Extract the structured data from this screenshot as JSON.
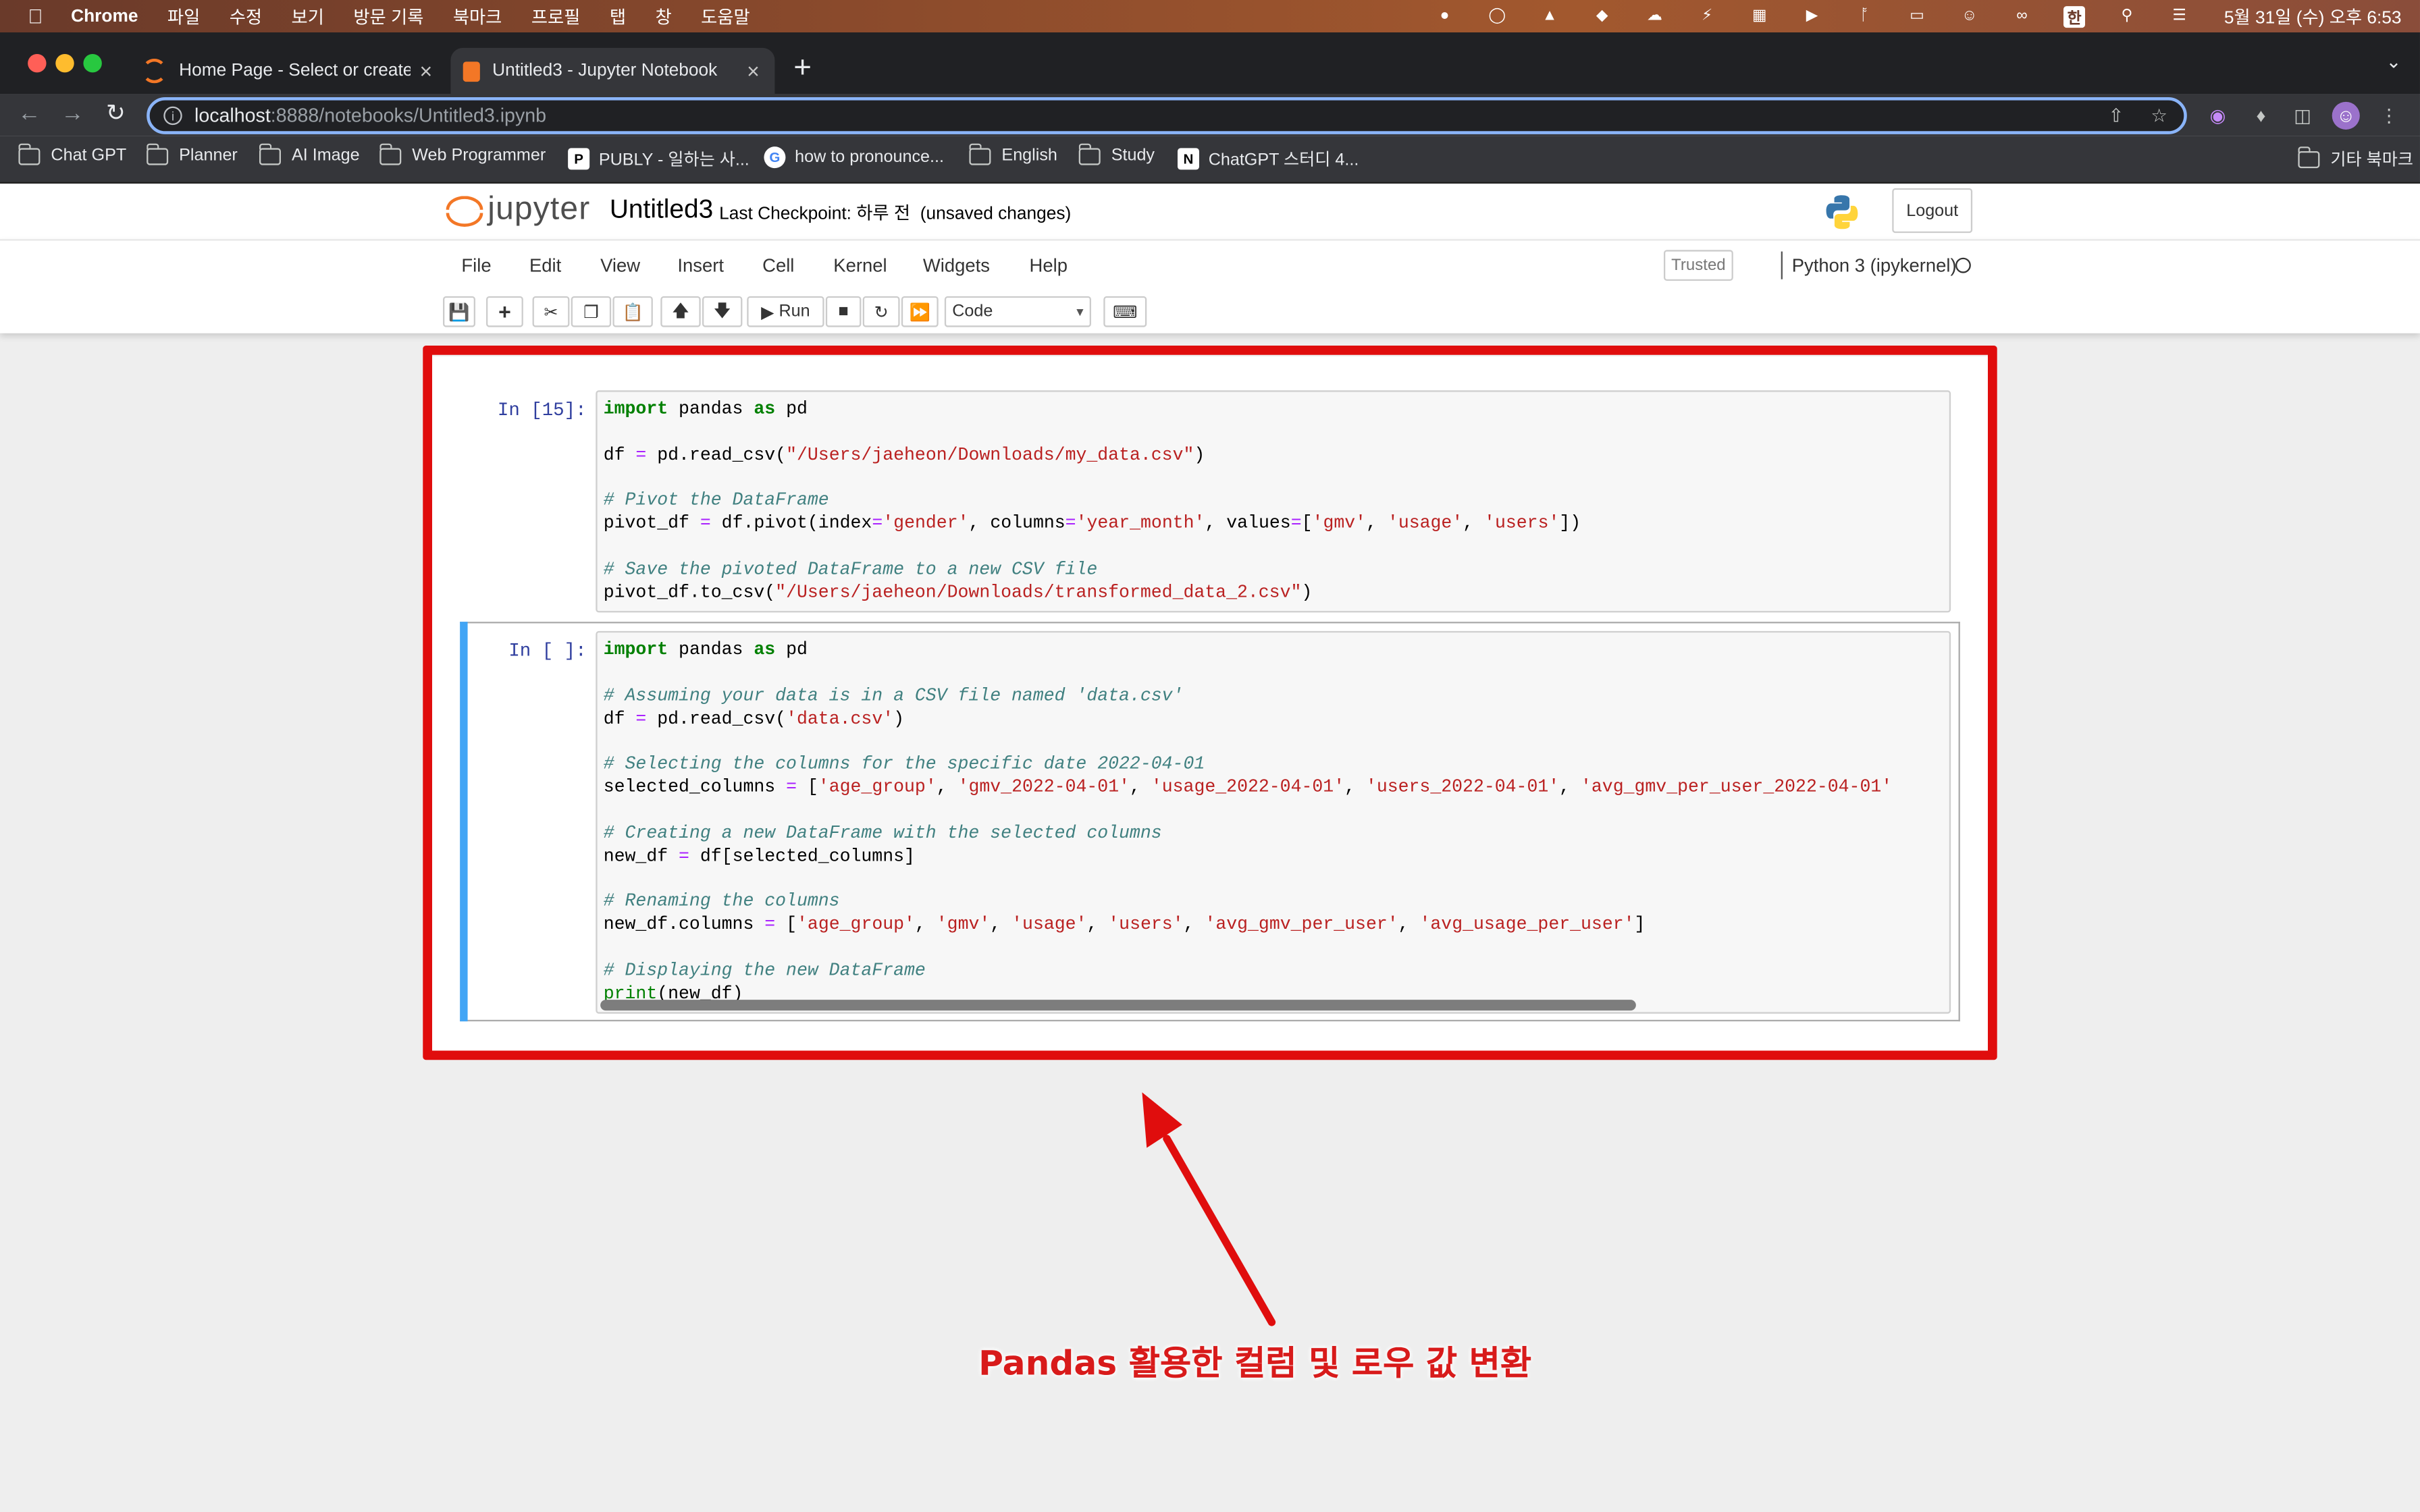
{
  "menubar": {
    "app": "Chrome",
    "items": [
      "파일",
      "수정",
      "보기",
      "방문 기록",
      "북마크",
      "프로필",
      "탭",
      "창",
      "도움말"
    ],
    "clock": "5월 31일 (수) 오후 6:53",
    "input_source": "한"
  },
  "tabs": [
    {
      "title": "Home Page - Select or create a notebook",
      "active": false
    },
    {
      "title": "Untitled3 - Jupyter Notebook",
      "active": true
    }
  ],
  "address_bar": {
    "host": "localhost",
    "rest": ":8888/notebooks/Untitled3.ipynb"
  },
  "bookmarks": [
    {
      "label": "Chat GPT",
      "type": "folder"
    },
    {
      "label": "Planner",
      "type": "folder"
    },
    {
      "label": "AI Image",
      "type": "folder"
    },
    {
      "label": "Web Programmer",
      "type": "folder"
    },
    {
      "label": "PUBLY - 일하는 사...",
      "type": "site"
    },
    {
      "label": "how to pronounce...",
      "type": "google"
    },
    {
      "label": "English",
      "type": "folder"
    },
    {
      "label": "Study",
      "type": "folder"
    },
    {
      "label": "ChatGPT 스터디 4...",
      "type": "notion"
    },
    {
      "label": "기타 북마크",
      "type": "folder"
    }
  ],
  "jupyter": {
    "logo_text": "jupyter",
    "notebook_name": "Untitled3",
    "checkpoint": "Last Checkpoint: 하루 전",
    "unsaved": "(unsaved changes)",
    "logout": "Logout",
    "menu": [
      "File",
      "Edit",
      "View",
      "Insert",
      "Cell",
      "Kernel",
      "Widgets",
      "Help"
    ],
    "trusted": "Trusted",
    "kernel": "Python 3 (ipykernel)",
    "run_label": "Run",
    "cell_type": "Code"
  },
  "cells": [
    {
      "prompt": "In [15]:"
    },
    {
      "prompt": "In [ ]:"
    }
  ],
  "annotation": {
    "caption_bold": "Pandas",
    "caption_rest": " 활용한 컬럼 및 로우 값 변환",
    "color": "#e00d0d"
  }
}
